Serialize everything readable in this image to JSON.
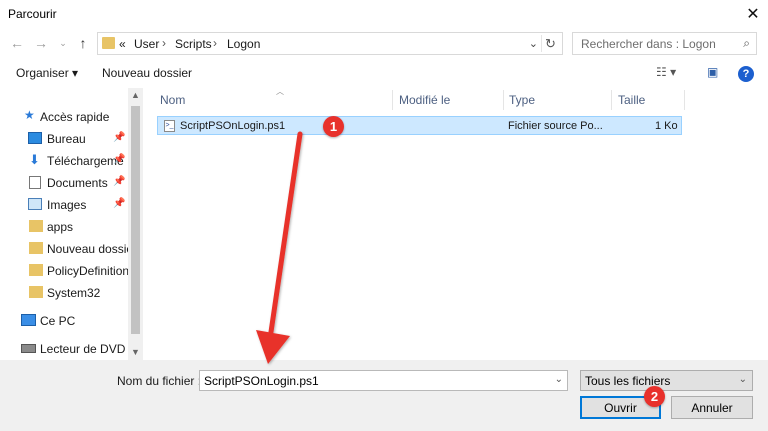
{
  "window": {
    "title": "Parcourir"
  },
  "nav": {
    "breadcrumb_prefix": "«",
    "breadcrumbs": [
      "User",
      "Scripts",
      "Logon"
    ],
    "search_placeholder": "Rechercher dans : Logon"
  },
  "toolbar": {
    "organize_label": "Organiser ▾",
    "new_folder_label": "Nouveau dossier"
  },
  "sidebar": {
    "items": [
      {
        "label": "Accès rapide",
        "icon": "star-icon",
        "pinned": false
      },
      {
        "label": "Bureau",
        "icon": "desktop-icon",
        "pinned": true
      },
      {
        "label": "Téléchargeme",
        "icon": "download-icon",
        "pinned": true
      },
      {
        "label": "Documents",
        "icon": "documents-icon",
        "pinned": true
      },
      {
        "label": "Images",
        "icon": "images-icon",
        "pinned": true
      },
      {
        "label": "apps",
        "icon": "folder-icon",
        "pinned": false
      },
      {
        "label": "Nouveau dossier",
        "icon": "folder-icon",
        "pinned": false
      },
      {
        "label": "PolicyDefinitions",
        "icon": "folder-icon",
        "pinned": false
      },
      {
        "label": "System32",
        "icon": "folder-icon",
        "pinned": false
      },
      {
        "label": "Ce PC",
        "icon": "computer-icon",
        "pinned": false
      },
      {
        "label": "Lecteur de DVD (D",
        "icon": "dvd-icon",
        "pinned": false
      }
    ]
  },
  "list": {
    "columns": [
      "Nom",
      "Modifié le",
      "Type",
      "Taille"
    ],
    "rows": [
      {
        "name": "ScriptPSOnLogin.ps1",
        "modified": "",
        "type": "Fichier source Po...",
        "size": "1 Ko",
        "selected": true
      }
    ]
  },
  "footer": {
    "filename_label": "Nom du fichier :",
    "filename_value": "ScriptPSOnLogin.ps1",
    "filter_value": "Tous les fichiers",
    "open_label": "Ouvrir",
    "cancel_label": "Annuler"
  },
  "annotations": {
    "step1": "1",
    "step2": "2"
  },
  "colors": {
    "selection": "#cde8ff",
    "accent": "#0078d7",
    "annotation": "#e8312c",
    "folder": "#e8c466"
  }
}
